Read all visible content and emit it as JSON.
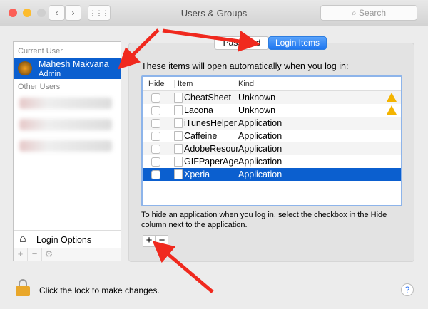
{
  "window": {
    "title": "Users & Groups",
    "search_placeholder": "Search"
  },
  "sidebar": {
    "current_user_label": "Current User",
    "user_name": "Mahesh Makvana",
    "user_role": "Admin",
    "other_users_label": "Other Users",
    "login_options": "Login Options"
  },
  "tabs": {
    "password": "Password",
    "login_items": "Login Items"
  },
  "main": {
    "heading": "These items will open automatically when you log in:",
    "columns": [
      "Hide",
      "Item",
      "Kind"
    ],
    "rows": [
      {
        "item": "CheatSheet",
        "kind": "Unknown",
        "warning": true
      },
      {
        "item": "Lacona",
        "kind": "Unknown",
        "warning": true
      },
      {
        "item": "iTunesHelper",
        "kind": "Application"
      },
      {
        "item": "Caffeine",
        "kind": "Application"
      },
      {
        "item": "AdobeResour",
        "kind": "Application"
      },
      {
        "item": "GIFPaperAge",
        "kind": "Application"
      },
      {
        "item": "Xperia",
        "kind": "Application",
        "selected": true
      }
    ],
    "note": "To hide an application when you log in, select the checkbox in the Hide column next to the application.",
    "add": "+",
    "remove": "−"
  },
  "footer": {
    "lock_text": "Click the lock to make changes.",
    "help": "?"
  }
}
